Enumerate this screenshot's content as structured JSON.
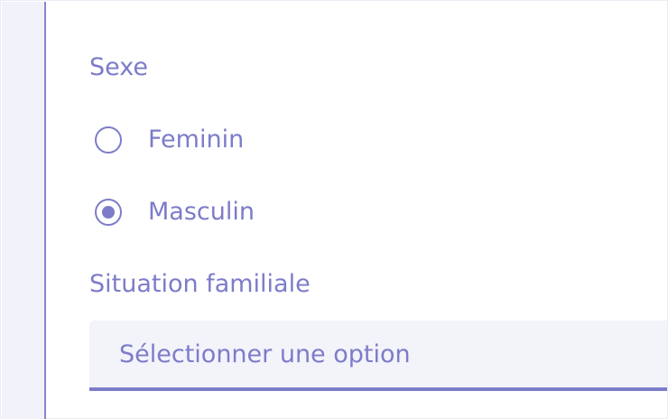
{
  "form": {
    "sexe": {
      "label": "Sexe",
      "options": [
        {
          "label": "Feminin",
          "selected": false
        },
        {
          "label": "Masculin",
          "selected": true
        }
      ]
    },
    "situation_familiale": {
      "label": "Situation familiale",
      "placeholder": "Sélectionner une option"
    }
  },
  "colors": {
    "accent": "#7c7cc9",
    "rail_bg": "#f2f2fb",
    "select_bg": "#f3f3fa"
  }
}
